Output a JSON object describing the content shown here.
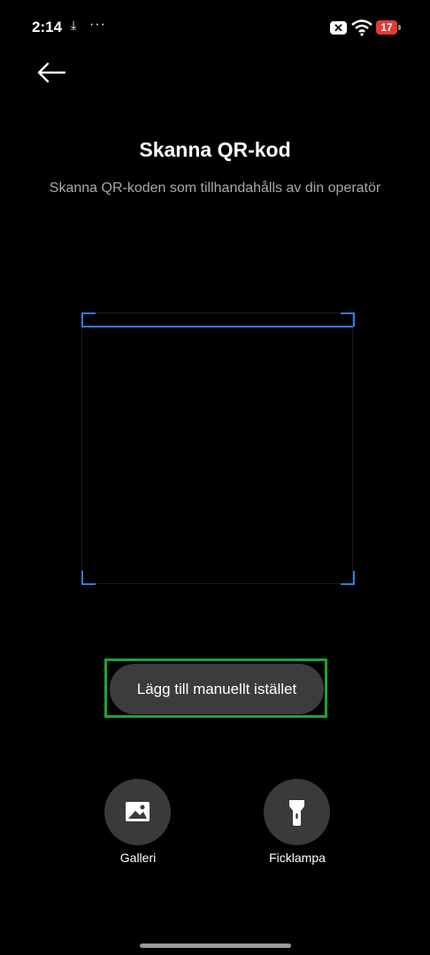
{
  "status_bar": {
    "time": "2:14",
    "download_icon": "download-icon",
    "more": "···",
    "sim_icon": "✕",
    "battery_level": "17",
    "battery_color": "#e53935"
  },
  "header": {
    "back_icon": "arrow-left-icon",
    "title": "Skanna QR-kod",
    "subtitle": "Skanna QR-koden som tillhandahålls av din operatör"
  },
  "scanner": {
    "accent_color": "#2f7ae5"
  },
  "actions": {
    "manual_label": "Lägg till manuellt istället",
    "gallery_label": "Galleri",
    "gallery_icon": "image-icon",
    "flashlight_label": "Ficklampa",
    "flashlight_icon": "flashlight-icon"
  }
}
